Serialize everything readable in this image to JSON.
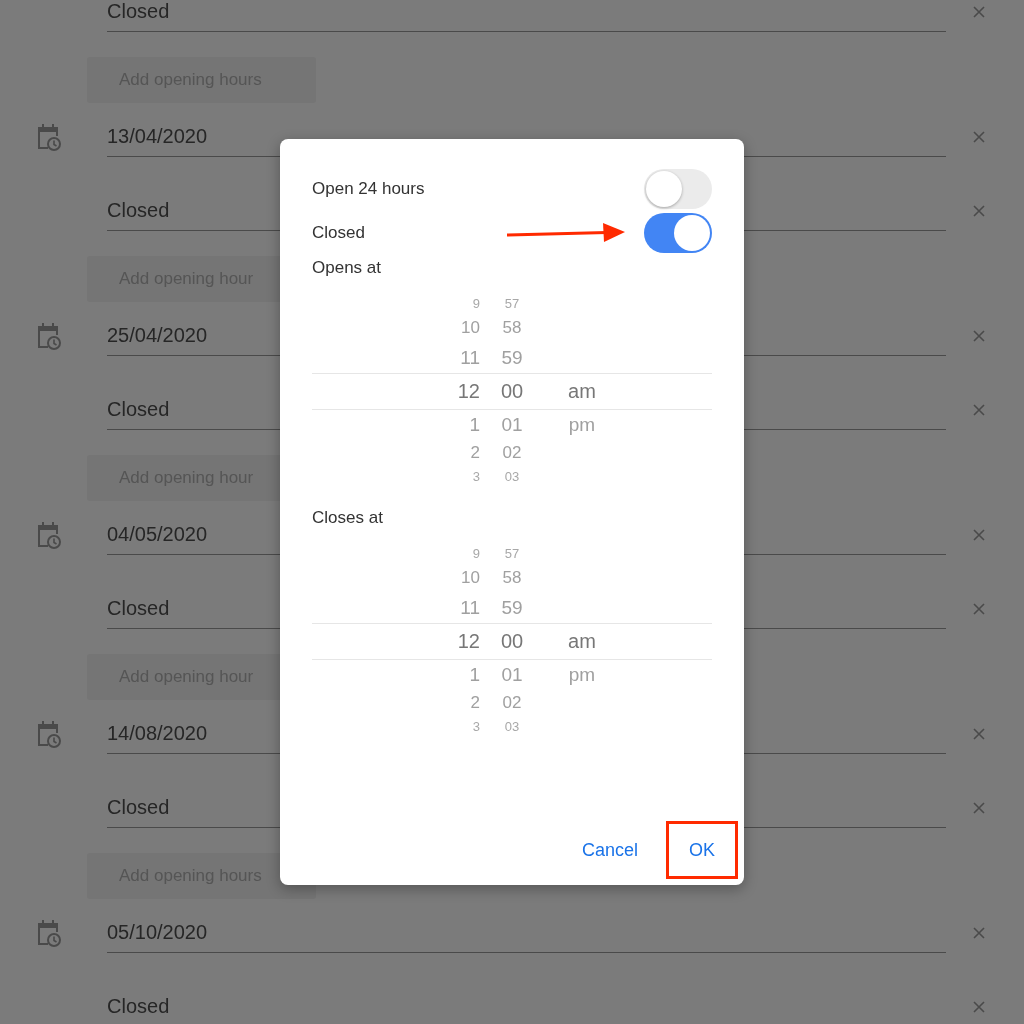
{
  "background_rows": [
    {
      "kind": "closed",
      "text": "Closed"
    },
    {
      "kind": "add",
      "text": "Add opening hours"
    },
    {
      "kind": "date",
      "text": "13/04/2020"
    },
    {
      "kind": "closed",
      "text": "Closed"
    },
    {
      "kind": "add",
      "text": "Add opening hour"
    },
    {
      "kind": "date",
      "text": "25/04/2020"
    },
    {
      "kind": "closed",
      "text": "Closed"
    },
    {
      "kind": "add",
      "text": "Add opening hour"
    },
    {
      "kind": "date",
      "text": "04/05/2020"
    },
    {
      "kind": "closed",
      "text": "Closed"
    },
    {
      "kind": "add",
      "text": "Add opening hour"
    },
    {
      "kind": "date",
      "text": "14/08/2020"
    },
    {
      "kind": "closed",
      "text": "Closed"
    },
    {
      "kind": "add",
      "text": "Add opening hours"
    },
    {
      "kind": "date",
      "text": "05/10/2020"
    },
    {
      "kind": "closed",
      "text": "Closed"
    }
  ],
  "dialog": {
    "toggles": [
      {
        "label": "Open 24 hours",
        "on": false,
        "pointed_at": false
      },
      {
        "label": "Closed",
        "on": true,
        "pointed_at": true
      }
    ],
    "pickers": [
      {
        "label": "Opens at",
        "columns": [
          [
            {
              "text": "9",
              "selected": false
            },
            {
              "text": "10",
              "selected": false
            },
            {
              "text": "11",
              "selected": false
            },
            {
              "text": "12",
              "selected": true
            },
            {
              "text": "1",
              "selected": false
            },
            {
              "text": "2",
              "selected": false
            },
            {
              "text": "3",
              "selected": false
            }
          ],
          [
            {
              "text": "57",
              "selected": false
            },
            {
              "text": "58",
              "selected": false
            },
            {
              "text": "59",
              "selected": false
            },
            {
              "text": "00",
              "selected": true
            },
            {
              "text": "01",
              "selected": false
            },
            {
              "text": "02",
              "selected": false
            },
            {
              "text": "03",
              "selected": false
            }
          ],
          [
            {
              "text": "am",
              "selected": true
            },
            {
              "text": "pm",
              "selected": false
            }
          ]
        ]
      },
      {
        "label": "Closes at",
        "columns": [
          [
            {
              "text": "9",
              "selected": false
            },
            {
              "text": "10",
              "selected": false
            },
            {
              "text": "11",
              "selected": false
            },
            {
              "text": "12",
              "selected": true
            },
            {
              "text": "1",
              "selected": false
            },
            {
              "text": "2",
              "selected": false
            },
            {
              "text": "3",
              "selected": false
            }
          ],
          [
            {
              "text": "57",
              "selected": false
            },
            {
              "text": "58",
              "selected": false
            },
            {
              "text": "59",
              "selected": false
            },
            {
              "text": "00",
              "selected": true
            },
            {
              "text": "01",
              "selected": false
            },
            {
              "text": "02",
              "selected": false
            },
            {
              "text": "03",
              "selected": false
            }
          ],
          [
            {
              "text": "am",
              "selected": true
            },
            {
              "text": "pm",
              "selected": false
            }
          ]
        ]
      }
    ],
    "buttons": [
      {
        "label": "Cancel",
        "highlighted": false
      },
      {
        "label": "OK",
        "highlighted": true
      }
    ]
  }
}
